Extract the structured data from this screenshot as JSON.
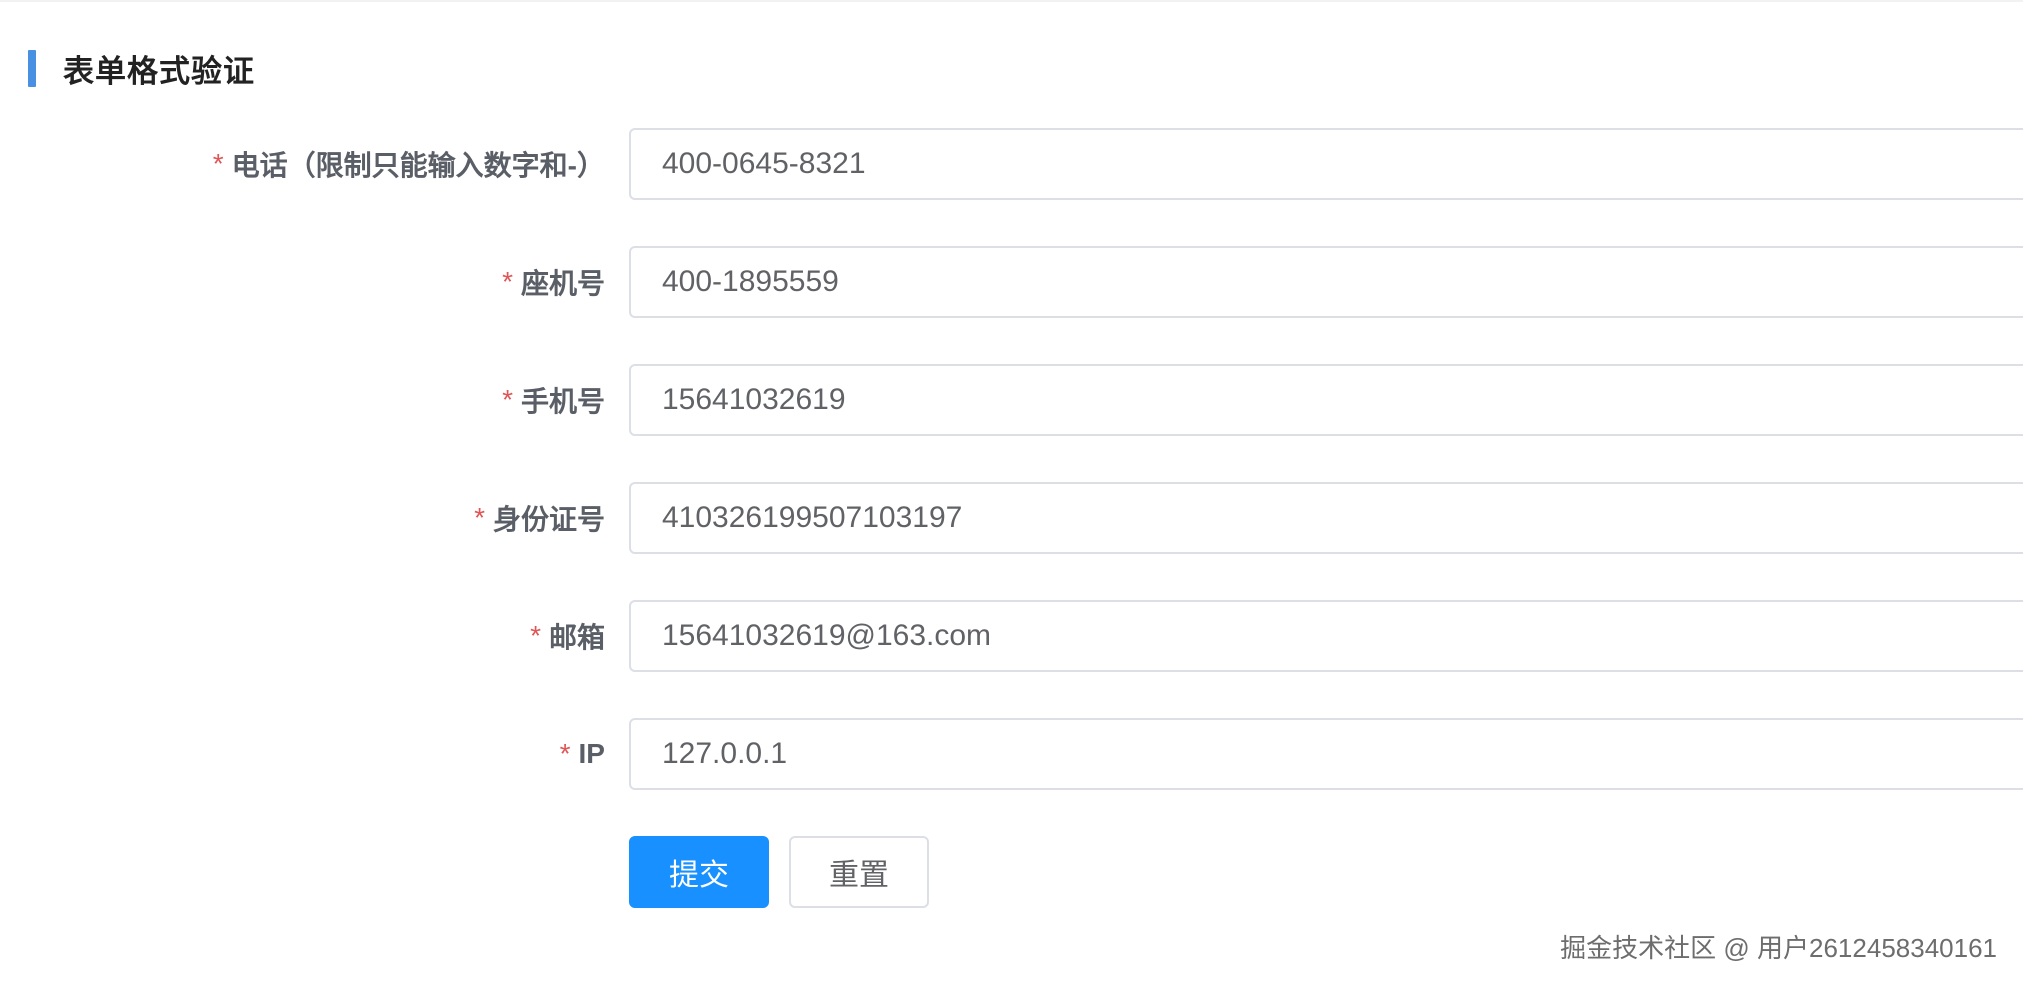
{
  "section": {
    "title": "表单格式验证"
  },
  "form": {
    "required_mark": "*",
    "fields": [
      {
        "label": "电话（限制只能输入数字和-）",
        "value": "400-0645-8321"
      },
      {
        "label": "座机号",
        "value": "400-1895559"
      },
      {
        "label": "手机号",
        "value": "15641032619"
      },
      {
        "label": "身份证号",
        "value": "410326199507103197"
      },
      {
        "label": "邮箱",
        "value": "15641032619@163.com"
      },
      {
        "label": "IP",
        "value": "127.0.0.1"
      }
    ],
    "submit_label": "提交",
    "reset_label": "重置"
  },
  "watermark": {
    "text": "掘金技术社区 @ 用户2612458340161"
  },
  "colors": {
    "accent_bar": "#4a90e2",
    "primary_button": "#1890ff",
    "required_star": "#e05656"
  }
}
